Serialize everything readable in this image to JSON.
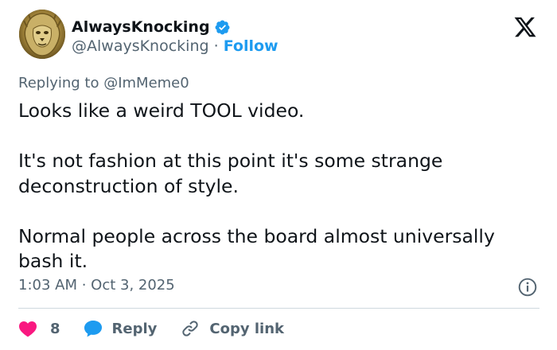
{
  "author": {
    "display_name": "AlwaysKnocking",
    "handle": "@AlwaysKnocking",
    "separator": " · ",
    "follow_label": "Follow"
  },
  "reply_context": {
    "prefix": "Replying to ",
    "mention": "@ImMeme0"
  },
  "tweet": {
    "paragraphs": [
      "Looks like a weird TOOL video.",
      "It's not fashion at this point it's some strange deconstruction of style.",
      "Normal people across the board almost universally bash it."
    ]
  },
  "meta": {
    "timestamp": "1:03 AM · Oct 3, 2025"
  },
  "actions": {
    "like_count": "8",
    "reply_label": "Reply",
    "copy_link_label": "Copy link"
  },
  "colors": {
    "accent": "#1d9bf0",
    "secondary_text": "#536471",
    "heart": "#f91880",
    "divider": "#cfd9de"
  },
  "icons": [
    "verified-badge-icon",
    "x-logo-icon",
    "info-icon",
    "heart-icon",
    "reply-bubble-icon",
    "link-icon"
  ]
}
